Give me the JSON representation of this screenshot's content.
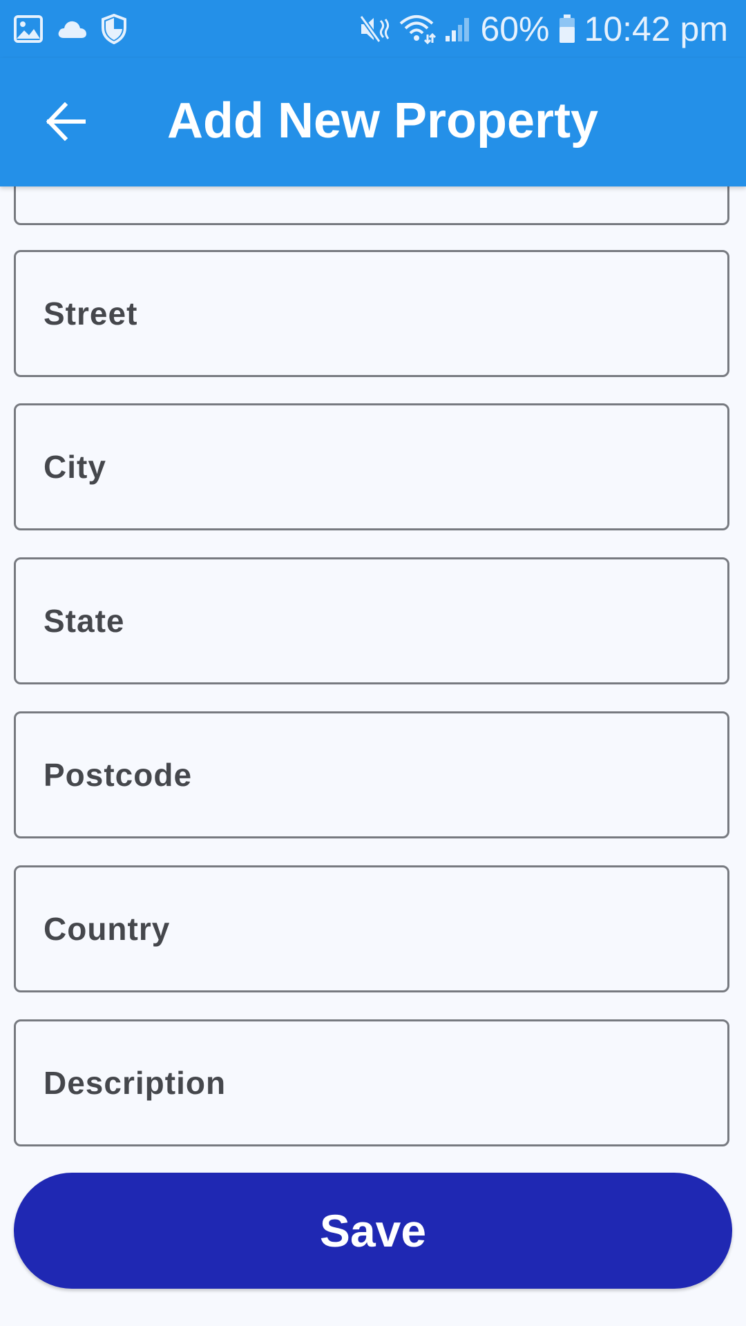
{
  "status_bar": {
    "battery_percent": "60%",
    "time": "10:42 pm",
    "icons": [
      "image-icon",
      "cloud-icon",
      "shield-icon",
      "mute-icon",
      "wifi-icon",
      "signal-icon",
      "battery-icon"
    ]
  },
  "app_bar": {
    "title": "Add New Property",
    "back_icon": "back-arrow-icon"
  },
  "form": {
    "fields": [
      {
        "name": "street",
        "placeholder": "Street",
        "value": ""
      },
      {
        "name": "city",
        "placeholder": "City",
        "value": ""
      },
      {
        "name": "state",
        "placeholder": "State",
        "value": ""
      },
      {
        "name": "postcode",
        "placeholder": "Postcode",
        "value": ""
      },
      {
        "name": "country",
        "placeholder": "Country",
        "value": ""
      },
      {
        "name": "description",
        "placeholder": "Description",
        "value": ""
      }
    ],
    "save_label": "Save"
  },
  "colors": {
    "app_bar": "#2490e8",
    "background": "#f7f9fe",
    "field_border": "#777a80",
    "field_text": "#45474c",
    "save_button": "#1f28b3"
  }
}
